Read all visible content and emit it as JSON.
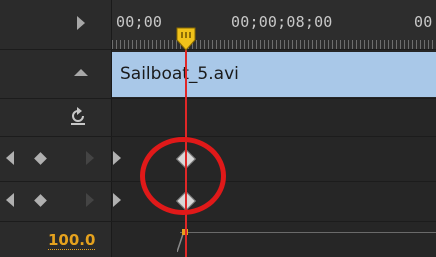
{
  "timeline": {
    "ruler": {
      "timecodes": [
        "00;00",
        "00;00;08;00",
        "00"
      ]
    },
    "clip": {
      "name": "Sailboat_5.avi",
      "color": "#a9c8e8"
    },
    "property": {
      "value": "100.0",
      "value_color": "#e5a21e"
    },
    "playhead": {
      "color": "#e02727"
    },
    "annotation": {
      "highlight_color": "#e01919"
    },
    "icons": {
      "toggle_expand": "play-right-icon",
      "collapse": "triangle-up-icon",
      "reset": "reset-icon",
      "prev_keyframe": "prev-keyframe-icon",
      "add_keyframe": "add-keyframe-icon",
      "next_keyframe": "next-keyframe-icon",
      "keyframe": "keyframe-diamond-icon"
    }
  }
}
